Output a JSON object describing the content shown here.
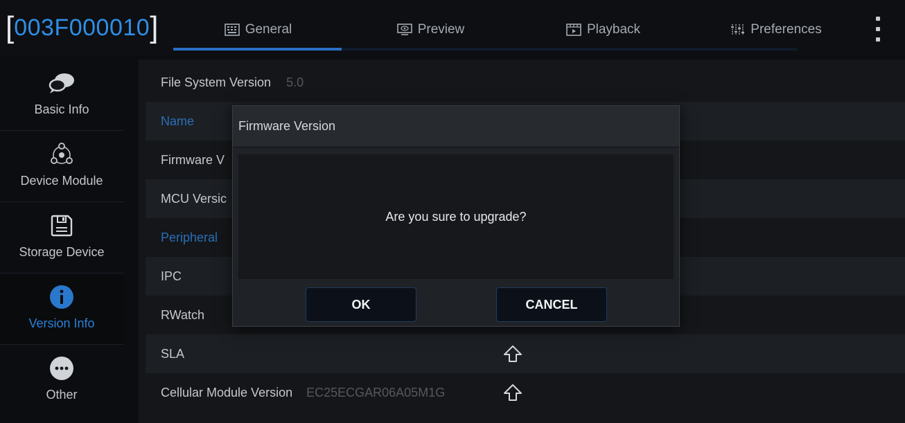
{
  "header": {
    "device_id": "003F000010",
    "bracket_open": "[",
    "bracket_close": "]"
  },
  "tabs": [
    {
      "label": "General",
      "icon": "keyboard-icon",
      "active": true
    },
    {
      "label": "Preview",
      "icon": "monitor-eye-icon",
      "active": false
    },
    {
      "label": "Playback",
      "icon": "film-icon",
      "active": false
    },
    {
      "label": "Preferences",
      "icon": "sliders-icon",
      "active": false
    }
  ],
  "sidebar": {
    "items": [
      {
        "label": "Basic Info",
        "icon": "chat-bubble-icon",
        "active": false
      },
      {
        "label": "Device Module",
        "icon": "module-network-icon",
        "active": false
      },
      {
        "label": "Storage Device",
        "icon": "floppy-disk-icon",
        "active": false
      },
      {
        "label": "Version Info",
        "icon": "info-icon",
        "active": true
      },
      {
        "label": "Other",
        "icon": "ellipsis-circle-icon",
        "active": false
      }
    ]
  },
  "content": {
    "rows": [
      {
        "label": "File System Version",
        "value": "5.0"
      },
      {
        "label": "Name",
        "value": ""
      },
      {
        "label": "Firmware V",
        "value": ""
      },
      {
        "label": "MCU Versic",
        "value": ""
      },
      {
        "label": "Peripheral",
        "value": ""
      },
      {
        "label": "IPC",
        "value": ""
      },
      {
        "label": "RWatch",
        "value": ""
      },
      {
        "label": "SLA",
        "value": ""
      },
      {
        "label": "Cellular Module Version",
        "value": "EC25ECGAR06A05M1G"
      }
    ]
  },
  "dialog": {
    "title": "Firmware Version",
    "message": "Are you sure to upgrade?",
    "ok_label": "OK",
    "cancel_label": "CANCEL"
  },
  "colors": {
    "accent": "#2a6fc4",
    "device_id": "#2f8fe6",
    "section_label": "#2a6fb8"
  }
}
